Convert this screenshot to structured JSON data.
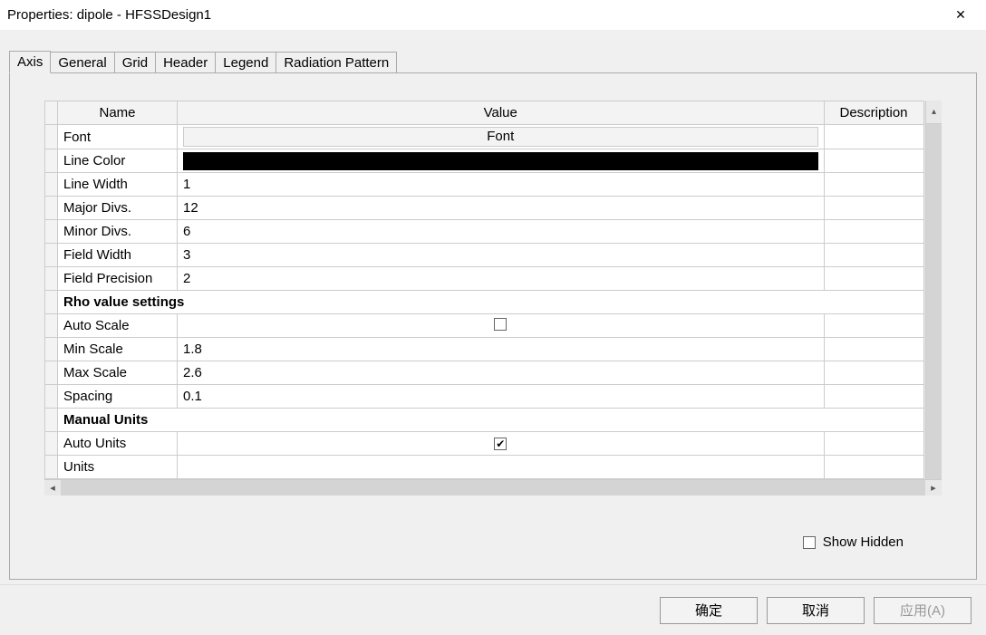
{
  "window": {
    "title": "Properties: dipole - HFSSDesign1"
  },
  "tabs": [
    "Axis",
    "General",
    "Grid",
    "Header",
    "Legend",
    "Radiation Pattern"
  ],
  "active_tab": 0,
  "columns": {
    "name": "Name",
    "value": "Value",
    "description": "Description"
  },
  "rows": [
    {
      "type": "font",
      "name": "Font",
      "value": "Font"
    },
    {
      "type": "color",
      "name": "Line Color",
      "value": "#000000"
    },
    {
      "type": "text",
      "name": "Line Width",
      "value": "1"
    },
    {
      "type": "text",
      "name": "Major Divs.",
      "value": "12"
    },
    {
      "type": "text",
      "name": "Minor Divs.",
      "value": "6"
    },
    {
      "type": "text",
      "name": "Field Width",
      "value": "3"
    },
    {
      "type": "text",
      "name": "Field Precision",
      "value": "2"
    },
    {
      "type": "group",
      "name": "Rho value settings"
    },
    {
      "type": "check",
      "name": "Auto Scale",
      "value": false
    },
    {
      "type": "text",
      "name": "Min Scale",
      "value": "1.8"
    },
    {
      "type": "text",
      "name": "Max Scale",
      "value": "2.6"
    },
    {
      "type": "text",
      "name": "Spacing",
      "value": "0.1"
    },
    {
      "type": "group",
      "name": "Manual Units"
    },
    {
      "type": "check",
      "name": "Auto Units",
      "value": true
    },
    {
      "type": "text",
      "name": "Units",
      "value": ""
    }
  ],
  "show_hidden": {
    "label": "Show Hidden",
    "checked": false
  },
  "buttons": {
    "ok": "确定",
    "cancel": "取消",
    "apply": "应用(A)"
  }
}
